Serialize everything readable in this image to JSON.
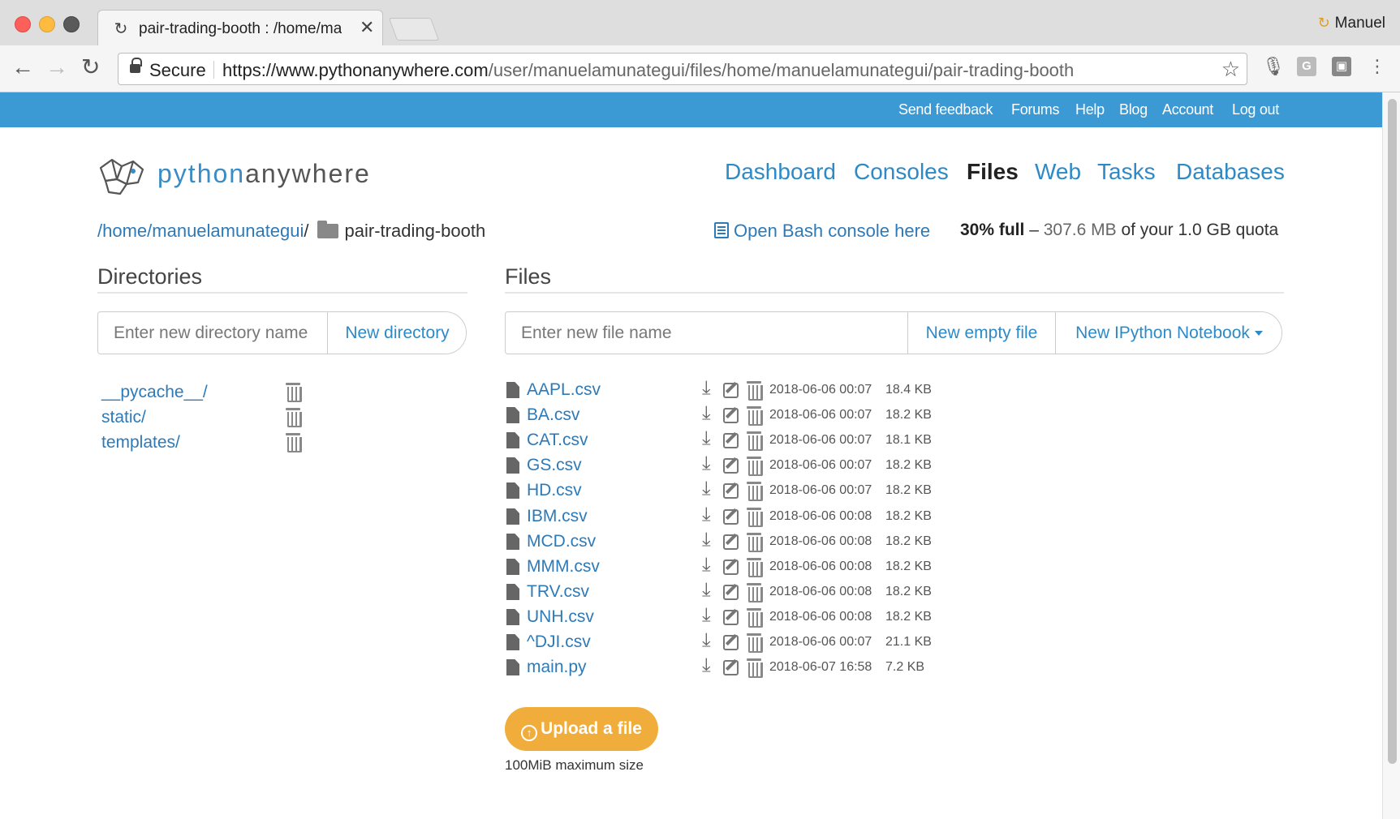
{
  "browser": {
    "tab_title": "pair-trading-booth : /home/ma",
    "profile_name": "Manuel",
    "secure_label": "Secure",
    "url_host": "https://www.pythonanywhere.com",
    "url_path": "/user/manuelamunategui/files/home/manuelamunategui/pair-trading-booth"
  },
  "topbar": {
    "links": [
      "Send feedback",
      "Forums",
      "Help",
      "Blog",
      "Account",
      "Log out"
    ]
  },
  "logo": {
    "python": "python",
    "anywhere": "anywhere"
  },
  "mainnav": {
    "dashboard": "Dashboard",
    "consoles": "Consoles",
    "files": "Files",
    "web": "Web",
    "tasks": "Tasks",
    "databases": "Databases"
  },
  "breadcrumb": {
    "root": "/home/",
    "user": "manuelamunategui",
    "sep": "/",
    "current": "pair-trading-booth"
  },
  "bash_link": "Open Bash console here",
  "quota": {
    "percent": "30% full",
    "dash": " – ",
    "used": "307.6 MB",
    "rest": " of your 1.0 GB quota"
  },
  "directories": {
    "title": "Directories",
    "input_placeholder": "Enter new directory name",
    "button": "New directory",
    "items": [
      "__pycache__/",
      "static/",
      "templates/"
    ]
  },
  "files": {
    "title": "Files",
    "input_placeholder": "Enter new file name",
    "new_empty_button": "New empty file",
    "new_notebook_button": "New IPython Notebook",
    "items": [
      {
        "name": "AAPL.csv",
        "date": "2018-06-06 00:07",
        "size": "18.4 KB"
      },
      {
        "name": "BA.csv",
        "date": "2018-06-06 00:07",
        "size": "18.2 KB"
      },
      {
        "name": "CAT.csv",
        "date": "2018-06-06 00:07",
        "size": "18.1 KB"
      },
      {
        "name": "GS.csv",
        "date": "2018-06-06 00:07",
        "size": "18.2 KB"
      },
      {
        "name": "HD.csv",
        "date": "2018-06-06 00:07",
        "size": "18.2 KB"
      },
      {
        "name": "IBM.csv",
        "date": "2018-06-06 00:08",
        "size": "18.2 KB"
      },
      {
        "name": "MCD.csv",
        "date": "2018-06-06 00:08",
        "size": "18.2 KB"
      },
      {
        "name": "MMM.csv",
        "date": "2018-06-06 00:08",
        "size": "18.2 KB"
      },
      {
        "name": "TRV.csv",
        "date": "2018-06-06 00:08",
        "size": "18.2 KB"
      },
      {
        "name": "UNH.csv",
        "date": "2018-06-06 00:08",
        "size": "18.2 KB"
      },
      {
        "name": "^DJI.csv",
        "date": "2018-06-06 00:07",
        "size": "21.1 KB"
      },
      {
        "name": "main.py",
        "date": "2018-06-07 16:58",
        "size": "7.2 KB"
      }
    ],
    "upload_button": "Upload a file",
    "upload_note": "100MiB maximum size"
  },
  "colors": {
    "topbar": "#3b99d4",
    "link": "#2d7ab9",
    "upload": "#f0ad3c"
  }
}
